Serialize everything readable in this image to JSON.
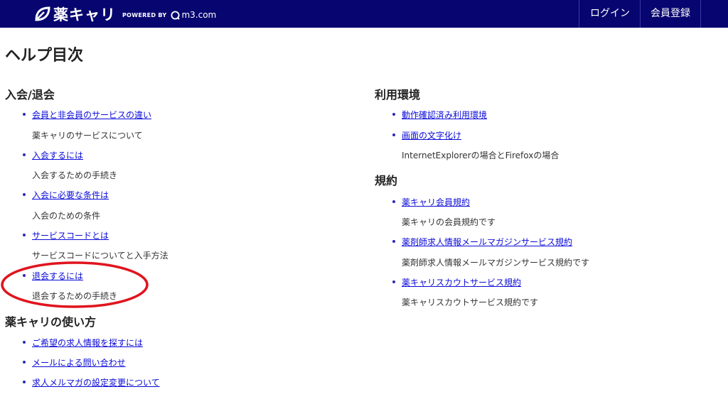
{
  "header": {
    "logo_text": "薬キャリ",
    "powered_by": "POWERED BY",
    "partner": "m3.com",
    "nav": {
      "login": "ログイン",
      "register": "会員登録"
    }
  },
  "page_title": "ヘルプ目次",
  "sections": {
    "membership": {
      "title": "入会/退会",
      "items": [
        {
          "link": "会員と非会員のサービスの違い",
          "desc": "薬キャリのサービスについて"
        },
        {
          "link": "入会するには",
          "desc": "入会するための手続き"
        },
        {
          "link": "入会に必要な条件は",
          "desc": "入会のための条件"
        },
        {
          "link": "サービスコードとは",
          "desc": "サービスコードについてと入手方法"
        },
        {
          "link": "退会するには",
          "desc": "退会するための手続き"
        }
      ]
    },
    "usage": {
      "title": "薬キャリの使い方",
      "items": [
        {
          "link": "ご希望の求人情報を探すには"
        },
        {
          "link": "メールによる問い合わせ"
        },
        {
          "link": "求人メルマガの設定変更について"
        }
      ]
    },
    "environment": {
      "title": "利用環境",
      "items": [
        {
          "link": "動作確認済み利用環境"
        },
        {
          "link": "画面の文字化け",
          "desc": "InternetExplorerの場合とFirefoxの場合"
        }
      ]
    },
    "terms": {
      "title": "規約",
      "items": [
        {
          "link": "薬キャリ会員規約",
          "desc": "薬キャリの会員規約です"
        },
        {
          "link": "薬剤師求人情報メールマガジンサービス規約",
          "desc": "薬剤師求人情報メールマガジンサービス規約です"
        },
        {
          "link": "薬キャリスカウトサービス規約",
          "desc": "薬キャリスカウトサービス規約です"
        }
      ]
    }
  },
  "colors": {
    "header_bg": "#070670",
    "link": "#0b0bd8",
    "highlight": "#e0141e"
  }
}
